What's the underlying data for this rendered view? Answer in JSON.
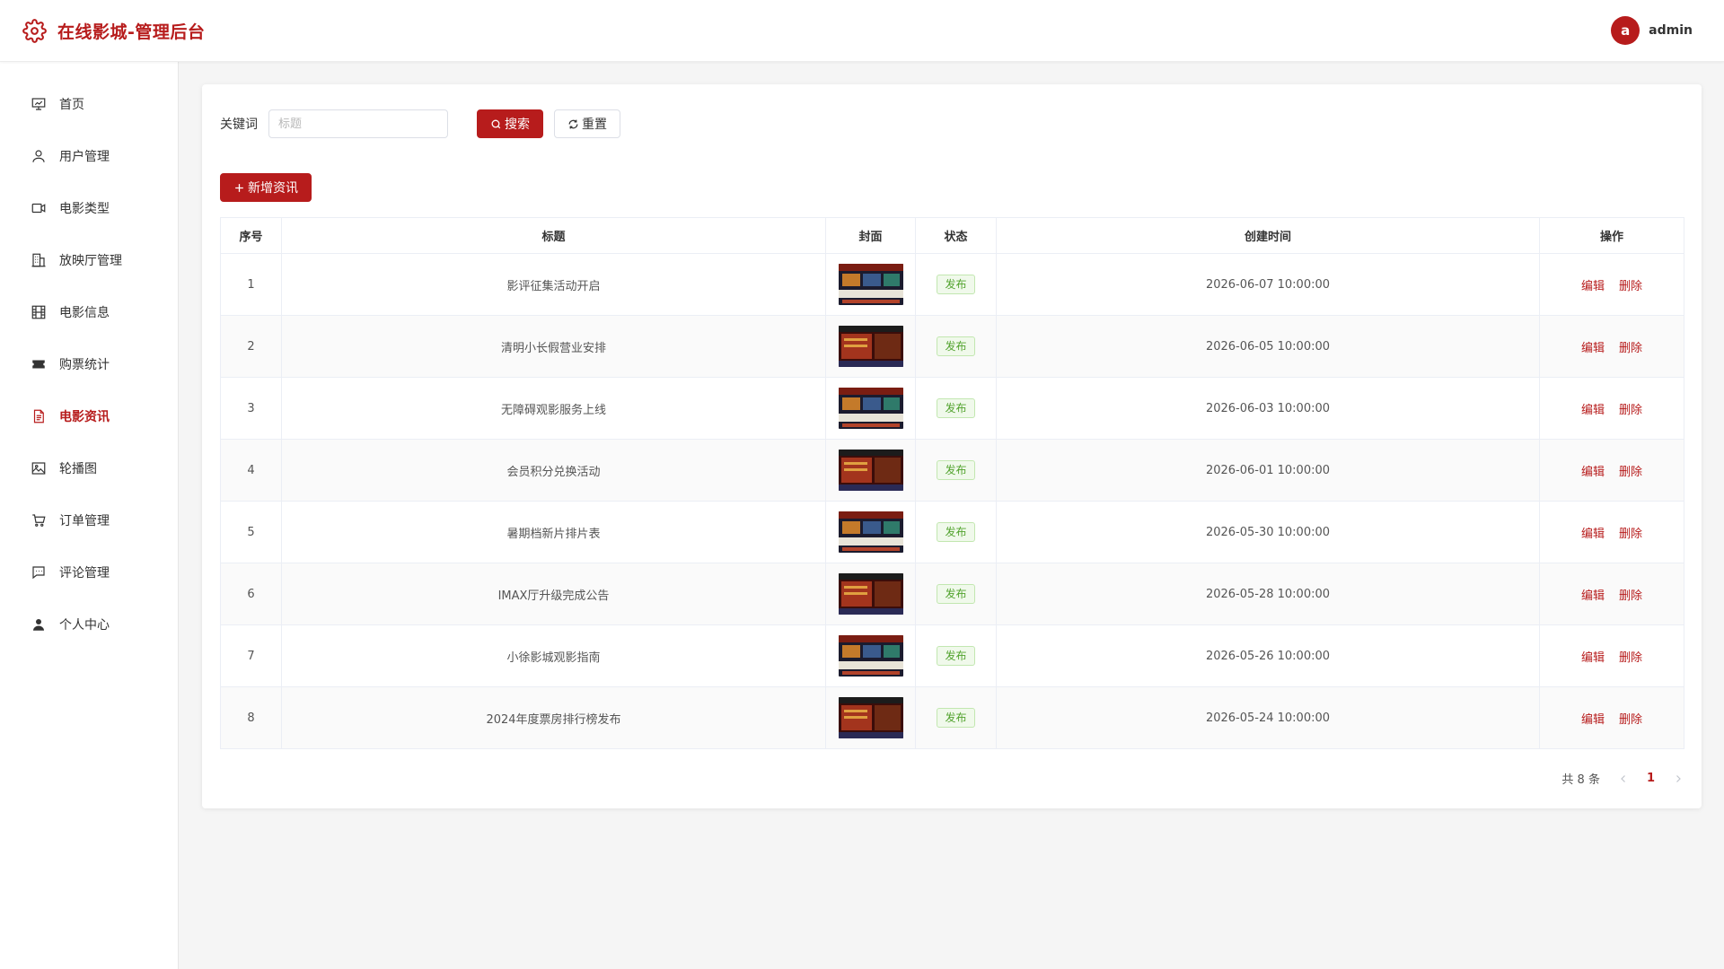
{
  "app": {
    "title": "在线影城-管理后台"
  },
  "user": {
    "avatar_letter": "a",
    "name": "admin"
  },
  "sidebar": {
    "items": [
      {
        "label": "首页",
        "icon": "dashboard-icon",
        "active": false
      },
      {
        "label": "用户管理",
        "icon": "user-icon",
        "active": false
      },
      {
        "label": "电影类型",
        "icon": "video-camera-icon",
        "active": false
      },
      {
        "label": "放映厅管理",
        "icon": "building-icon",
        "active": false
      },
      {
        "label": "电影信息",
        "icon": "film-icon",
        "active": false
      },
      {
        "label": "购票统计",
        "icon": "ticket-icon",
        "active": false
      },
      {
        "label": "电影资讯",
        "icon": "document-icon",
        "active": true
      },
      {
        "label": "轮播图",
        "icon": "picture-icon",
        "active": false
      },
      {
        "label": "订单管理",
        "icon": "cart-icon",
        "active": false
      },
      {
        "label": "评论管理",
        "icon": "comment-icon",
        "active": false
      },
      {
        "label": "个人中心",
        "icon": "person-icon",
        "active": false
      }
    ]
  },
  "search": {
    "label": "关键词",
    "placeholder": "标题",
    "value": "",
    "search_button": "搜索",
    "reset_button": "重置"
  },
  "toolbar": {
    "add_button": "新增资讯"
  },
  "table": {
    "columns": [
      "序号",
      "标题",
      "封面",
      "状态",
      "创建时间",
      "操作"
    ],
    "rows": [
      {
        "index": "1",
        "title": "影评征集活动开启",
        "status": "发布",
        "created": "2026-06-07 10:00:00"
      },
      {
        "index": "2",
        "title": "清明小长假营业安排",
        "status": "发布",
        "created": "2026-06-05 10:00:00"
      },
      {
        "index": "3",
        "title": "无障碍观影服务上线",
        "status": "发布",
        "created": "2026-06-03 10:00:00"
      },
      {
        "index": "4",
        "title": "会员积分兑换活动",
        "status": "发布",
        "created": "2026-06-01 10:00:00"
      },
      {
        "index": "5",
        "title": "暑期档新片排片表",
        "status": "发布",
        "created": "2026-05-30 10:00:00"
      },
      {
        "index": "6",
        "title": "IMAX厅升级完成公告",
        "status": "发布",
        "created": "2026-05-28 10:00:00"
      },
      {
        "index": "7",
        "title": "小徐影城观影指南",
        "status": "发布",
        "created": "2026-05-26 10:00:00"
      },
      {
        "index": "8",
        "title": "2024年度票房排行榜发布",
        "status": "发布",
        "created": "2026-05-24 10:00:00"
      }
    ],
    "edit_label": "编辑",
    "delete_label": "删除"
  },
  "pagination": {
    "total_text": "共 8 条",
    "current_page": "1"
  },
  "colors": {
    "accent": "#b71c1c",
    "status_green": "#52a32e",
    "background": "#f5f5f5"
  }
}
